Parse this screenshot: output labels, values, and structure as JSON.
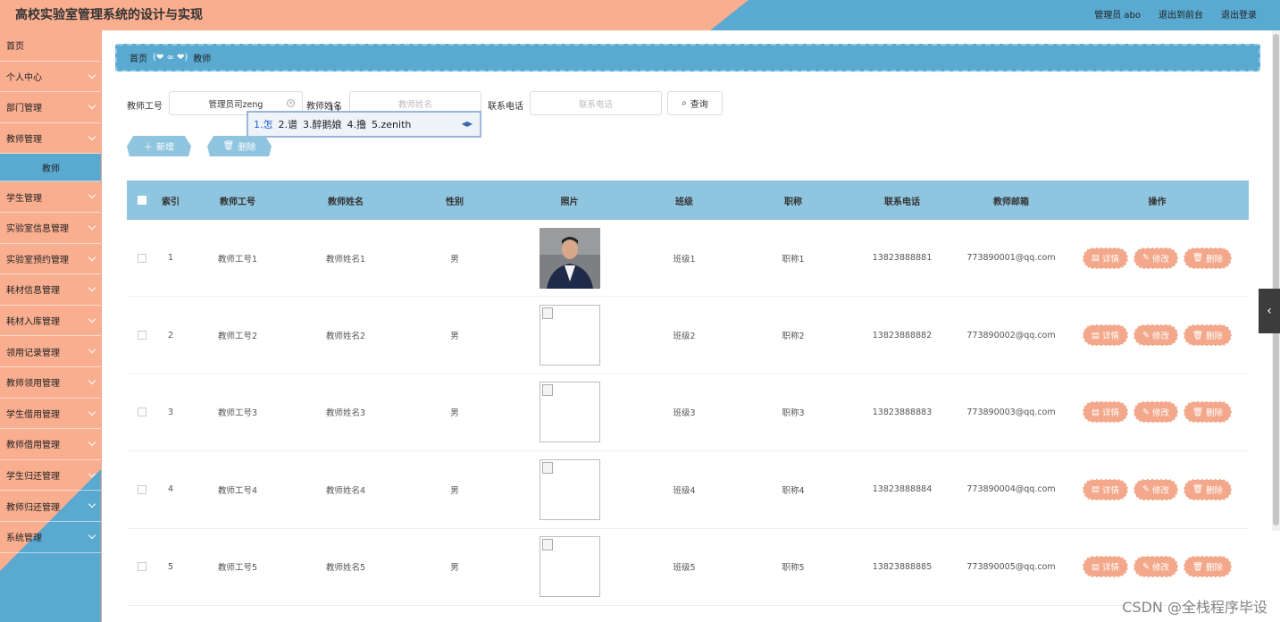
{
  "app": {
    "title": "高校实验室管理系统的设计与实现"
  },
  "header": {
    "user": "管理员 abo",
    "to_front": "退出到前台",
    "logout": "退出登录"
  },
  "sidebar": {
    "items": [
      {
        "label": "首页"
      },
      {
        "label": "个人中心"
      },
      {
        "label": "部门管理"
      },
      {
        "label": "教师管理"
      },
      {
        "label": "教师",
        "sub": true
      },
      {
        "label": "学生管理"
      },
      {
        "label": "实验室信息管理"
      },
      {
        "label": "实验室预约管理"
      },
      {
        "label": "耗材信息管理"
      },
      {
        "label": "耗材入库管理"
      },
      {
        "label": "领用记录管理"
      },
      {
        "label": "教师领用管理"
      },
      {
        "label": "学生借用管理"
      },
      {
        "label": "教师借用管理"
      },
      {
        "label": "学生归还管理"
      },
      {
        "label": "教师归还管理"
      },
      {
        "label": "系统管理"
      }
    ]
  },
  "breadcrumb": {
    "home": "首页",
    "current": "教师"
  },
  "search": {
    "teacher_no_label": "教师工号",
    "teacher_no_value": "管理员司zeng",
    "teacher_name_label": "教师姓名",
    "teacher_name_placeholder": "教师姓名",
    "phone_label": "联系电话",
    "phone_placeholder": "联系电话",
    "query_button": "查询"
  },
  "ime": {
    "candidates": [
      "1.怎",
      "2.谱",
      "3.醉鹅娘",
      "4.撸",
      "5.zenith"
    ]
  },
  "actions": {
    "add": "新增",
    "delete": "删除"
  },
  "table": {
    "headers": [
      "索引",
      "教师工号",
      "教师姓名",
      "性别",
      "照片",
      "班级",
      "职称",
      "联系电话",
      "教师邮箱",
      "操作"
    ],
    "rows": [
      {
        "idx": "1",
        "no": "教师工号1",
        "name": "教师姓名1",
        "sex": "男",
        "cls": "班级1",
        "title": "职称1",
        "phone": "13823888881",
        "mail": "773890001@qq.com"
      },
      {
        "idx": "2",
        "no": "教师工号2",
        "name": "教师姓名2",
        "sex": "男",
        "cls": "班级2",
        "title": "职称2",
        "phone": "13823888882",
        "mail": "773890002@qq.com"
      },
      {
        "idx": "3",
        "no": "教师工号3",
        "name": "教师姓名3",
        "sex": "男",
        "cls": "班级3",
        "title": "职称3",
        "phone": "13823888883",
        "mail": "773890003@qq.com"
      },
      {
        "idx": "4",
        "no": "教师工号4",
        "name": "教师姓名4",
        "sex": "男",
        "cls": "班级4",
        "title": "职称4",
        "phone": "13823888884",
        "mail": "773890004@qq.com"
      },
      {
        "idx": "5",
        "no": "教师工号5",
        "name": "教师姓名5",
        "sex": "男",
        "cls": "班级5",
        "title": "职称5",
        "phone": "13823888885",
        "mail": "773890005@qq.com"
      }
    ],
    "op_detail": "详情",
    "op_edit": "修改",
    "op_delete": "删除"
  },
  "watermark": "CSDN @全栈程序毕设",
  "colors": {
    "peach": "#f9ae90",
    "blue": "#5aa9d1",
    "header_blue": "#8fc5df"
  }
}
